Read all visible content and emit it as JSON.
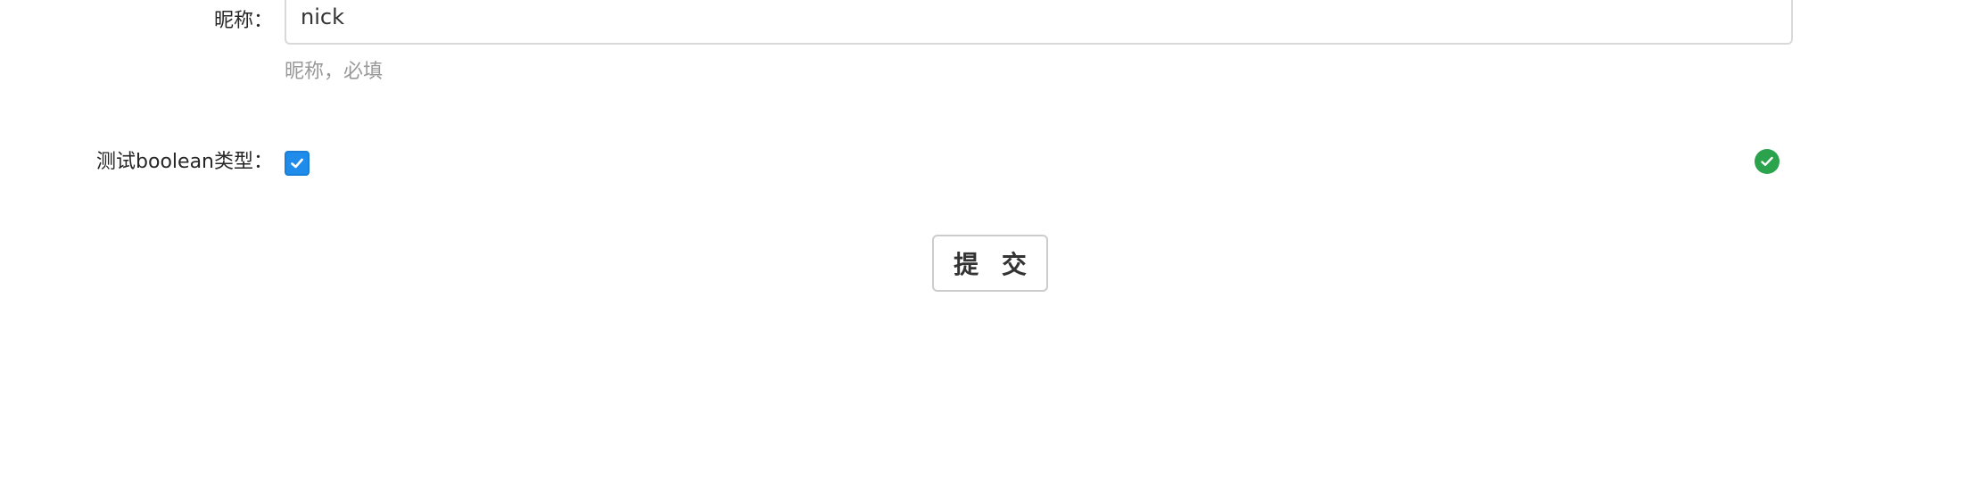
{
  "form": {
    "nickname": {
      "label": "昵称：",
      "value": "nick",
      "help": "昵称，必填"
    },
    "test_boolean": {
      "label": "测试boolean类型：",
      "checked": true
    },
    "status_icon": "check-circle-icon",
    "submit_label": "提 交"
  },
  "colors": {
    "checkbox_checked": "#1f8ceb",
    "success": "#2ba24c",
    "help_text": "#999999",
    "border": "#d9d9d9"
  }
}
